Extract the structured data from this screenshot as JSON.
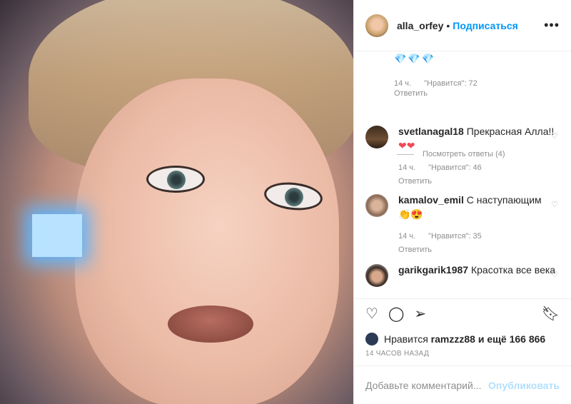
{
  "post": {
    "username": "alla_orfey",
    "dot": "•",
    "follow_label": "Подписаться",
    "more_icon": "•••"
  },
  "comments": {
    "top": {
      "emoji": "💎💎💎",
      "time": "14 ч.",
      "likes": "\"Нравится\": 72",
      "reply": "Ответить",
      "view_replies": "Посмотреть ответы (4)"
    },
    "items": [
      {
        "username": "svetlanagal18",
        "text": "Прекрасная Алла!!",
        "emoji": "❤❤",
        "time": "14 ч.",
        "likes": "\"Нравится\": 46",
        "reply": "Ответить"
      },
      {
        "username": "kamalov_emil",
        "text": "С наступающим",
        "emoji": "👏😍",
        "time": "14 ч.",
        "likes": "\"Нравится\": 35",
        "reply": "Ответить"
      },
      {
        "username": "garikgarik1987",
        "text": "Красотка все века"
      }
    ]
  },
  "likes": {
    "prefix": "Нравится",
    "user": "ramzzz88",
    "suffix": "и ещё 166 866"
  },
  "time": "14 ЧАСОВ НАЗАД",
  "add_comment": {
    "placeholder": "Добавьте комментарий...",
    "publish": "Опубликовать"
  },
  "colors": {
    "accent": "#0095f6",
    "publish_disabled": "#b2dffc",
    "heart_red": "#ed4956"
  }
}
